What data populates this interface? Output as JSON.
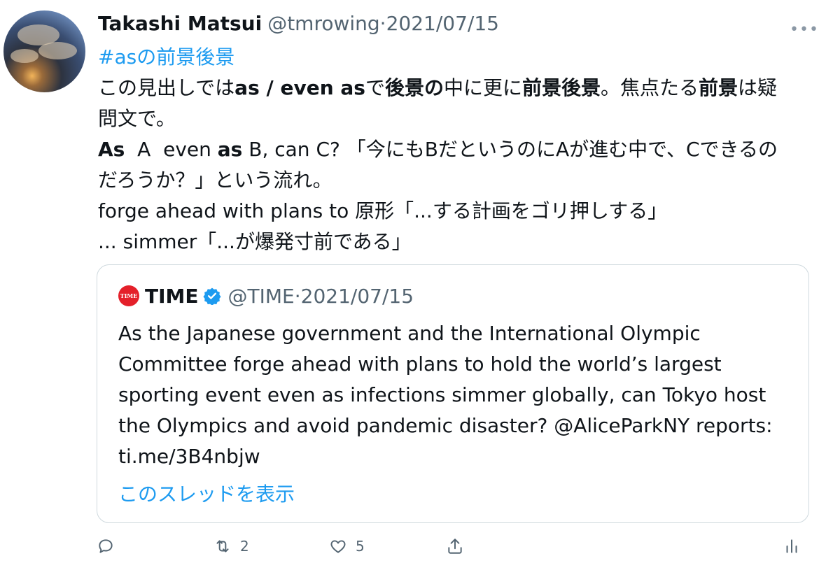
{
  "tweet": {
    "name": "Takashi Matsui",
    "handle": "@tmrowing",
    "separator": "·",
    "date": "2021/07/15",
    "hashtag": "#asの前景後景",
    "line1": [
      "この見出しでは",
      "as / even as",
      "で",
      "後景の",
      "中に更に",
      "前景後景",
      "。焦点たる",
      "前景",
      "は疑"
    ],
    "line2": "問文で。",
    "line3": [
      "As",
      "  A  even ",
      "as",
      " B, can C? 「今にもBだというのにAが進む中で、Cできるの"
    ],
    "line4": "だろうか？」という流れ。",
    "line5": "forge ahead with plans to 原形「...する計画をゴリ押しする」",
    "line6": "... simmer「...が爆発寸前である」"
  },
  "quote": {
    "logo_text": "TIME",
    "name": "TIME",
    "handle": "@TIME",
    "separator": "·",
    "date": "2021/07/15",
    "lines": [
      "As the Japanese government and the International Olympic",
      "Committee forge ahead with plans to hold the world’s largest",
      "sporting event even as infections simmer globally, can Tokyo host",
      "the Olympics and avoid pandemic disaster? @AliceParkNY reports:",
      "ti.me/3B4nbjw"
    ],
    "thread_link": "このスレッドを表示"
  },
  "actions": {
    "reply_icon": "reply-icon",
    "retweet_icon": "retweet-icon",
    "retweet_count": "2",
    "like_icon": "heart-icon",
    "like_count": "5",
    "share_icon": "share-icon",
    "analytics_icon": "analytics-icon"
  },
  "more_icon": "•••",
  "colors": {
    "link": "#1d9bf0",
    "secondary": "#536471",
    "border": "#cfd9de",
    "time_red": "#e4202a"
  }
}
